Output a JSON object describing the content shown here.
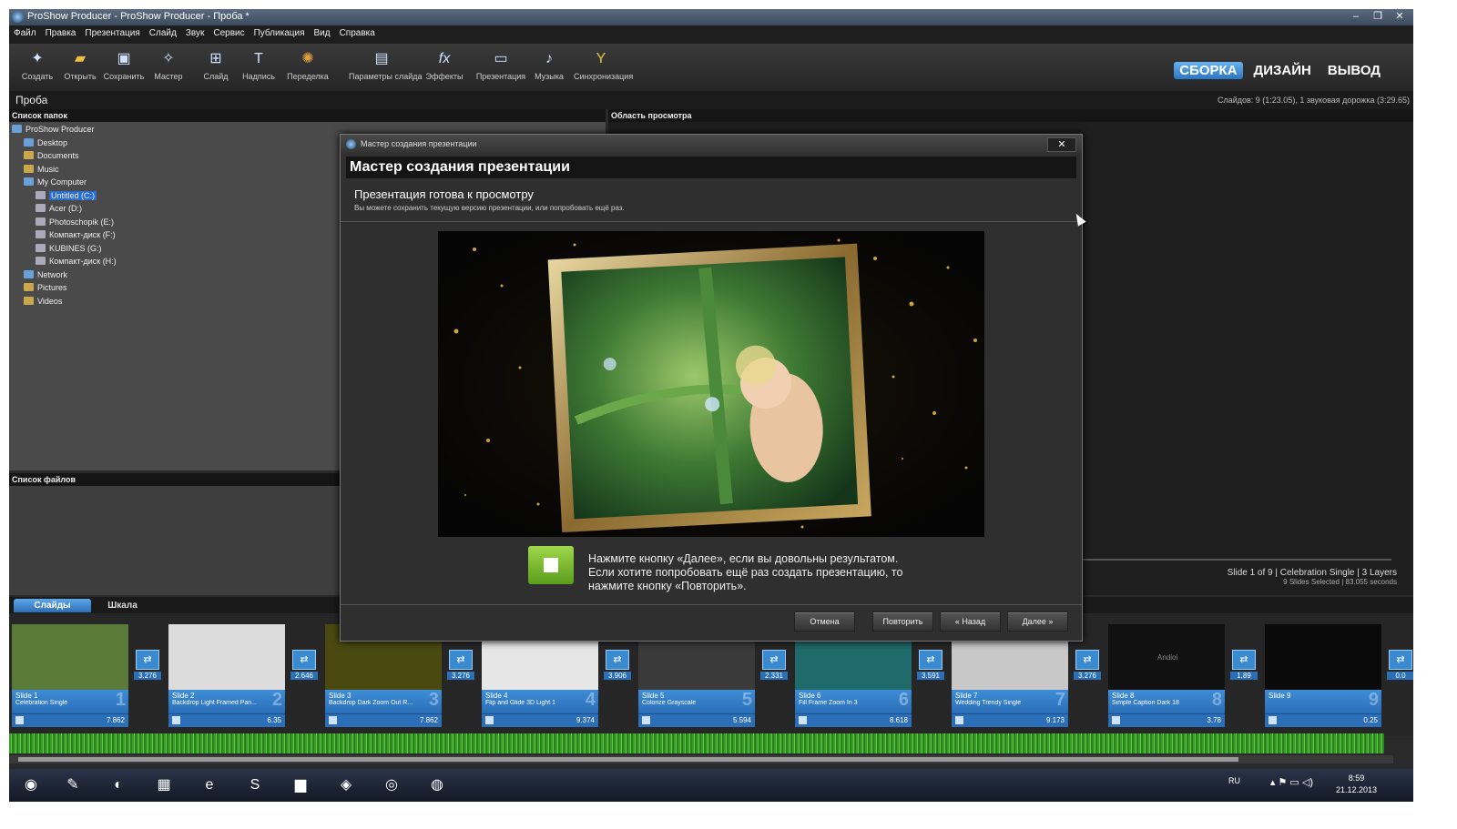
{
  "window": {
    "title": "ProShow Producer - ProShow Producer - Проба *",
    "controls": [
      "–",
      "❐",
      "✕"
    ]
  },
  "menu": [
    "Файл",
    "Правка",
    "Презентация",
    "Слайд",
    "Звук",
    "Сервис",
    "Публикация",
    "Вид",
    "Справка"
  ],
  "toolbar": {
    "buttons": [
      {
        "label": "Создать",
        "icon": "create-icon"
      },
      {
        "label": "Открыть",
        "icon": "open-folder-icon"
      },
      {
        "label": "Сохранить",
        "icon": "save-icon"
      },
      {
        "label": "Мастер",
        "icon": "wizard-icon"
      },
      {
        "label": "Слайд",
        "icon": "add-slide-icon"
      },
      {
        "label": "Надпись",
        "icon": "caption-icon"
      },
      {
        "label": "Переделка",
        "icon": "remix-icon"
      },
      {
        "label": "Параметры слайда",
        "icon": "slide-options-icon"
      },
      {
        "label": "Эффекты",
        "icon": "effects-icon"
      },
      {
        "label": "Презентация",
        "icon": "presentation-icon"
      },
      {
        "label": "Музыка",
        "icon": "music-icon"
      },
      {
        "label": "Синхронизация",
        "icon": "sync-icon"
      }
    ],
    "modes": [
      "СБОРКА",
      "ДИЗАЙН",
      "ВЫВОД"
    ],
    "active_mode": "СБОРКА",
    "accent": "#2a76c2"
  },
  "project": {
    "name": "Проба",
    "info": "Слайдов: 9 (1:23.05), 1 звуковая дорожка (3:29.65)"
  },
  "folders": {
    "header": "Список папок",
    "items": [
      {
        "label": "ProShow Producer",
        "level": 0,
        "icon": "app-icon"
      },
      {
        "label": "Desktop",
        "level": 1,
        "icon": "desktop-icon"
      },
      {
        "label": "Documents",
        "level": 1,
        "icon": "folder-icon"
      },
      {
        "label": "Music",
        "level": 1,
        "icon": "folder-icon"
      },
      {
        "label": "My Computer",
        "level": 1,
        "icon": "computer-icon"
      },
      {
        "label": "Untitled (C:)",
        "level": 2,
        "icon": "drive-icon",
        "selected": true
      },
      {
        "label": "Acer (D:)",
        "level": 2,
        "icon": "drive-icon"
      },
      {
        "label": "Photoschopik (E:)",
        "level": 2,
        "icon": "drive-icon"
      },
      {
        "label": "Компакт-диск (F:)",
        "level": 2,
        "icon": "cd-drive-icon"
      },
      {
        "label": "KUBINES (G:)",
        "level": 2,
        "icon": "drive-icon"
      },
      {
        "label": "Компакт-диск (H:)",
        "level": 2,
        "icon": "cd-drive-icon"
      },
      {
        "label": "Network",
        "level": 1,
        "icon": "network-icon"
      },
      {
        "label": "Pictures",
        "level": 1,
        "icon": "folder-icon"
      },
      {
        "label": "Videos",
        "level": 1,
        "icon": "folder-icon"
      }
    ]
  },
  "files": {
    "header": "Список файлов"
  },
  "preview": {
    "header": "Область просмотра",
    "slide_info": "Slide 1 of 9 | Celebration Single | 3 Layers",
    "selection_info": "9 Slides Selected | 83.055 seconds"
  },
  "dialog": {
    "window_title": "Мастер создания презентации",
    "heading": "Мастер создания презентации",
    "subheading": "Презентация готова к просмотру",
    "description": "Вы можете сохранить текущую версию презентации, или попробовать ещё раз.",
    "message": "Нажмите кнопку «Далее», если вы довольны результатом. Если хотите попробовать ещё раз создать презентацию, то нажмите кнопку «Повторить».",
    "buttons": {
      "cancel": "Отмена",
      "retry": "Повторить",
      "back": "« Назад",
      "next": "Далее »"
    },
    "close": "✕",
    "done_color": "#7cbd2e"
  },
  "tabs": {
    "slides": "Слайды",
    "timeline": "Шкала"
  },
  "slides": [
    {
      "name": "Slide 1",
      "style": "Celebration Single",
      "num": "1",
      "duration": "7.862",
      "transition": "3.276",
      "thumb": "#5a7a3a"
    },
    {
      "name": "Slide 2",
      "style": "Backdrop Light Framed Pan...",
      "num": "2",
      "duration": "6.35",
      "transition": "2.646",
      "thumb": "#dcdcdc"
    },
    {
      "name": "Slide 3",
      "style": "Backdrop Dark Zoom Out R...",
      "num": "3",
      "duration": "7.862",
      "transition": "3.276",
      "thumb": "#4a4a10"
    },
    {
      "name": "Slide 4",
      "style": "Flip and Glide 3D Light 1",
      "num": "4",
      "duration": "9.374",
      "transition": "3.906",
      "thumb": "#e6e6e6"
    },
    {
      "name": "Slide 5",
      "style": "Colorize Grayscale",
      "num": "5",
      "duration": "5.594",
      "transition": "2.331",
      "thumb": "#3a3a3a"
    },
    {
      "name": "Slide 6",
      "style": "Fill Frame Zoom In 3",
      "num": "6",
      "duration": "8.618",
      "transition": "3.591",
      "thumb": "#1f6a6a"
    },
    {
      "name": "Slide 7",
      "style": "Wedding Trendy Single",
      "num": "7",
      "duration": "9.173",
      "transition": "3.276",
      "thumb": "#c8c8c8"
    },
    {
      "name": "Slide 8",
      "style": "Simple Caption Dark 18",
      "num": "8",
      "duration": "3.78",
      "transition": "1.89",
      "thumb": "#111111",
      "caption": "Andioi"
    },
    {
      "name": "Slide 9",
      "style": "",
      "num": "9",
      "duration": "0.25",
      "transition": "0.0",
      "thumb": "#0a0a0a"
    }
  ],
  "taskbar": {
    "lang": "RU",
    "time": "8:59",
    "date": "21.12.2013",
    "apps": [
      "start-orb-icon",
      "paint-icon",
      "firefox-icon",
      "network-app-icon",
      "ie-icon",
      "skype-icon",
      "explorer-icon",
      "media-icon",
      "chrome-icon",
      "proshow-icon"
    ]
  }
}
